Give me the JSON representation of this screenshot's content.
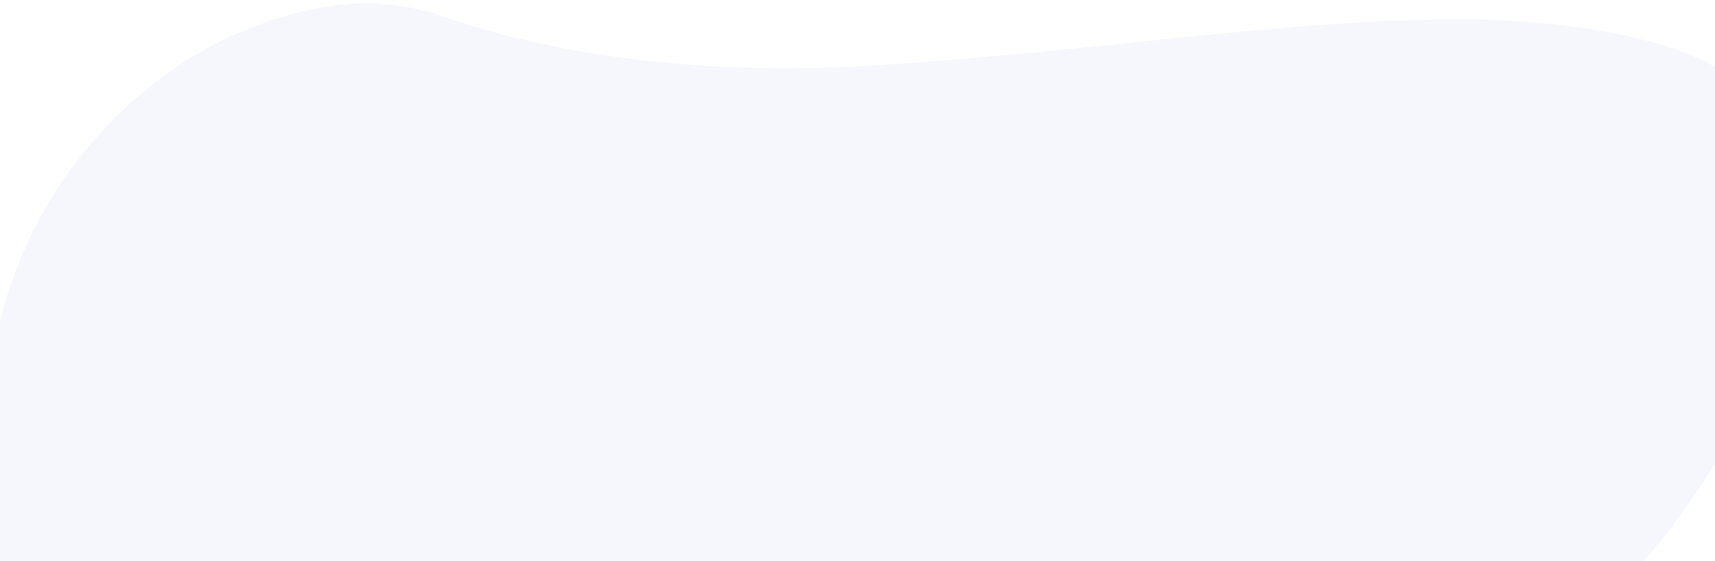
{
  "background": {
    "page_color": "#ffffff",
    "blob_color": "#f6f7fc"
  }
}
